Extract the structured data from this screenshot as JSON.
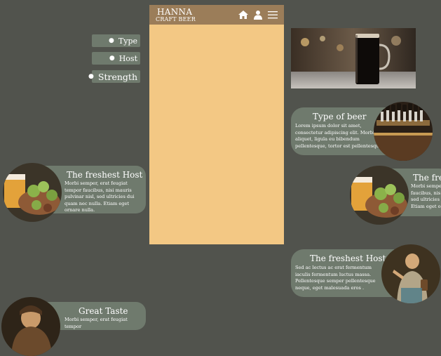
{
  "nav": {
    "items": [
      {
        "label": "Type"
      },
      {
        "label": "Host"
      },
      {
        "label": "Strength"
      }
    ]
  },
  "phone": {
    "brand_line1": "HANNA",
    "brand_line2": "CRAFT BEER",
    "icons": [
      "home-icon",
      "user-icon",
      "menu-icon"
    ]
  },
  "cards": {
    "host_left": {
      "title": "The freshest Host",
      "text": "Morbi semper, erat feugiat tempor faucibus, nisi mauris pulvinar nisl, sed ultricies dui quam nec nulla. Etiam eget ornare nulla."
    },
    "taste_left": {
      "title": "Great Taste",
      "text": "Morbi semper, erat feugiat tempor"
    },
    "type_right": {
      "title": "Type of beer",
      "text": "Lorem ipsum dolor sit amet, consectetur adipiscing elit. Morbi aliquet, ligula eu bibendum pellentesque, tortor est pellentesque"
    },
    "fresh_right_partial": {
      "title": "The fre",
      "text": "Morbi sempe faucibus, nis sed ultricies c Etiam eget o"
    },
    "host_right": {
      "title": "The freshest Host",
      "text": "Sed ac lectus ac erat fermentum iaculis fermentum luctus massa. Pellentesque semper pellentesque neque, eget malesuada eros ."
    }
  },
  "colors": {
    "background": "#51534d",
    "card": "#6f7a6d",
    "phone_body": "#f3c884",
    "phone_header": "#9b7d59"
  }
}
